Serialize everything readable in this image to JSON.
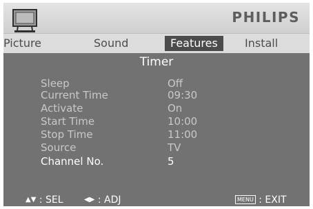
{
  "brand": "PHILIPS",
  "tabs": [
    {
      "label": "Picture",
      "active": false
    },
    {
      "label": "Sound",
      "active": false
    },
    {
      "label": "Features",
      "active": true
    },
    {
      "label": "Install",
      "active": false
    }
  ],
  "menu_title": "Timer",
  "items": [
    {
      "label": "Sleep",
      "value": "Off"
    },
    {
      "label": "Current Time",
      "value": "09:30"
    },
    {
      "label": "Activate",
      "value": "On"
    },
    {
      "label": "Start Time",
      "value": "10:00"
    },
    {
      "label": "Stop Time",
      "value": "11:00"
    },
    {
      "label": "Source",
      "value": "TV"
    },
    {
      "label": "Channel No.",
      "value": "5",
      "selected": true
    }
  ],
  "footer": {
    "sel_label": ": SEL",
    "adj_label": ": ADJ",
    "menu_key": "MENU",
    "exit_label": ": EXIT"
  },
  "colors": {
    "panel": "#727272",
    "header": "#dcdcdc",
    "active_tab": "#4b4b4b",
    "text_dim": "#c9c9c9",
    "text_selected": "#ffffff"
  },
  "icons": [
    "tv-icon",
    "up-down-arrow-icon",
    "left-right-arrow-icon",
    "menu-key-icon"
  ]
}
